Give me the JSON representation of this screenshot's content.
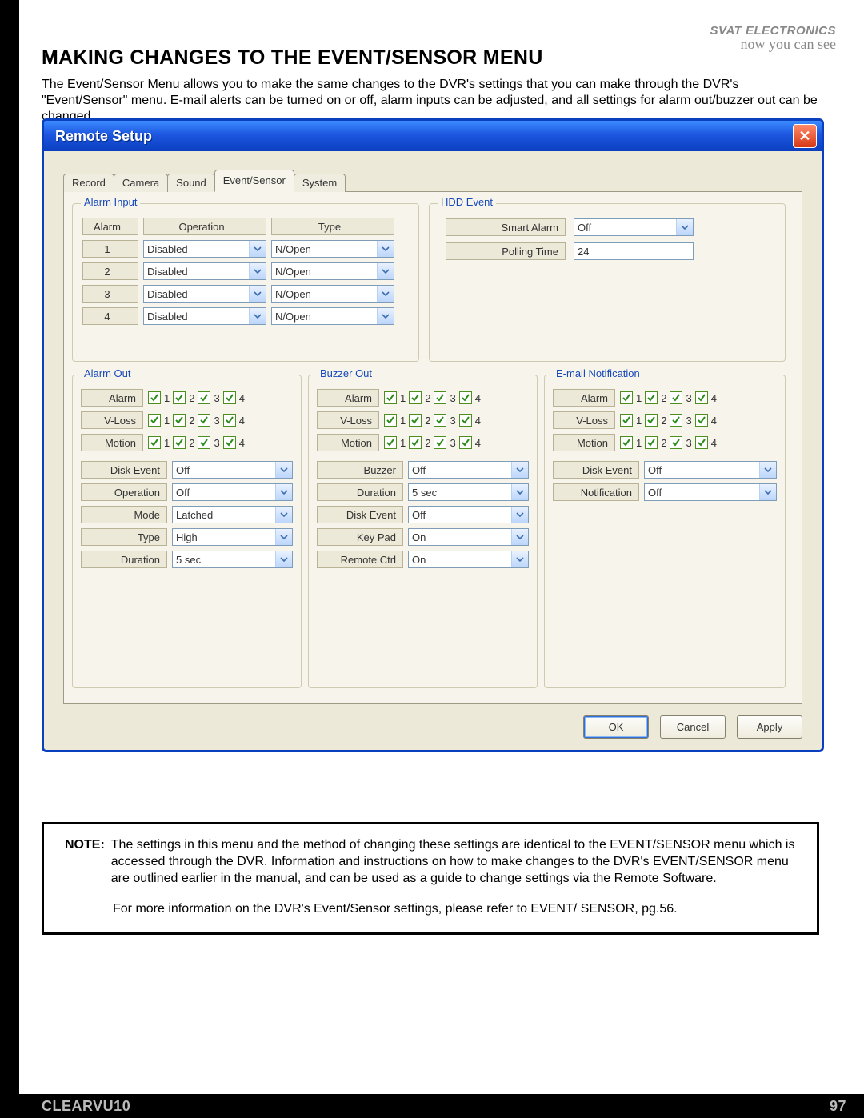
{
  "brand": {
    "name": "SVAT ELECTRONICS",
    "tag": "now you can see"
  },
  "heading": "MAKING CHANGES TO THE EVENT/SENSOR MENU",
  "paragraph": "The Event/Sensor Menu allows you to make the same changes to the DVR's settings that you can make through the DVR's \"Event/Sensor\" menu. E-mail alerts can be turned on or off, alarm inputs can be adjusted, and all settings for alarm out/buzzer out can be changed.",
  "window": {
    "title": "Remote Setup",
    "close_symbol": "✕",
    "tabs": [
      "Record",
      "Camera",
      "Sound",
      "Event/Sensor",
      "System"
    ],
    "active_tab": 3,
    "buttons": {
      "ok": "OK",
      "cancel": "Cancel",
      "apply": "Apply"
    }
  },
  "alarm_input": {
    "legend": "Alarm Input",
    "headers": {
      "alarm": "Alarm",
      "operation": "Operation",
      "type": "Type"
    },
    "rows": [
      {
        "n": "1",
        "op": "Disabled",
        "type": "N/Open"
      },
      {
        "n": "2",
        "op": "Disabled",
        "type": "N/Open"
      },
      {
        "n": "3",
        "op": "Disabled",
        "type": "N/Open"
      },
      {
        "n": "4",
        "op": "Disabled",
        "type": "N/Open"
      }
    ]
  },
  "hdd_event": {
    "legend": "HDD Event",
    "smart_alarm": {
      "label": "Smart Alarm",
      "value": "Off"
    },
    "polling_time": {
      "label": "Polling Time",
      "value": "24"
    }
  },
  "checkbox_rows": {
    "items": [
      {
        "label": "Alarm",
        "checks": [
          true,
          true,
          true,
          true
        ]
      },
      {
        "label": "V-Loss",
        "checks": [
          true,
          true,
          true,
          true
        ]
      },
      {
        "label": "Motion",
        "checks": [
          true,
          true,
          true,
          true
        ]
      }
    ],
    "nums": [
      "1",
      "2",
      "3",
      "4"
    ]
  },
  "alarm_out": {
    "legend": "Alarm Out",
    "opts": [
      {
        "label": "Disk Event",
        "value": "Off"
      },
      {
        "label": "Operation",
        "value": "Off"
      },
      {
        "label": "Mode",
        "value": "Latched"
      },
      {
        "label": "Type",
        "value": "High"
      },
      {
        "label": "Duration",
        "value": "5 sec"
      }
    ]
  },
  "buzzer_out": {
    "legend": "Buzzer Out",
    "opts": [
      {
        "label": "Buzzer",
        "value": "Off"
      },
      {
        "label": "Duration",
        "value": "5 sec"
      },
      {
        "label": "Disk Event",
        "value": "Off"
      },
      {
        "label": "Key Pad",
        "value": "On"
      },
      {
        "label": "Remote Ctrl",
        "value": "On"
      }
    ]
  },
  "email": {
    "legend": "E-mail Notification",
    "opts": [
      {
        "label": "Disk Event",
        "value": "Off"
      },
      {
        "label": "Notification",
        "value": "Off"
      }
    ]
  },
  "note": {
    "label": "NOTE:",
    "body": "The settings in this menu and the method of changing these settings are identical to the EVENT/SENSOR menu which is accessed through the DVR.  Information and instructions on how to make changes to the DVR's EVENT/SENSOR menu are outlined earlier in the manual, and can be used as a guide to change settings via the Remote Software.",
    "more": "For more information on the DVR's Event/Sensor settings, please refer to EVENT/ SENSOR, pg.56."
  },
  "footer": {
    "product": "CLEARVU10",
    "page": "97"
  }
}
